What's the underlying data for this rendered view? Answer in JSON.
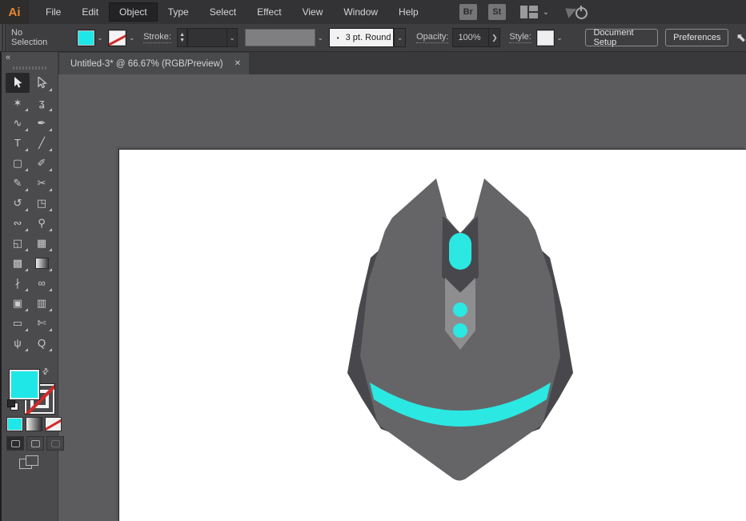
{
  "app": {
    "logo_text": "Ai"
  },
  "menu_bar": {
    "items": [
      "File",
      "Edit",
      "Object",
      "Type",
      "Select",
      "Effect",
      "View",
      "Window",
      "Help"
    ],
    "active_item": "Object",
    "bridge_button": "Br",
    "stock_button": "St"
  },
  "control_bar": {
    "selection_status": "No Selection",
    "stroke_label": "Stroke:",
    "stroke_width_value": "",
    "brush_bullet": "•",
    "brush_value": "3 pt. Round",
    "opacity_label": "Opacity:",
    "opacity_value": "100%",
    "style_label": "Style:",
    "document_setup_label": "Document Setup",
    "preferences_label": "Preferences"
  },
  "document_tab": {
    "title": "Untitled-3* @ 66.67% (RGB/Preview)"
  },
  "toolbar": {
    "tools": [
      {
        "name": "selection-tool",
        "icon": "selection-tool-icon",
        "active": true
      },
      {
        "name": "direct-selection-tool",
        "icon": "direct-selection-tool-icon",
        "active": false
      },
      {
        "name": "magic-wand-tool",
        "icon": "magic-wand-tool-icon",
        "active": false
      },
      {
        "name": "lasso-tool",
        "icon": "lasso-tool-icon",
        "active": false
      },
      {
        "name": "curvature-tool",
        "icon": "curvature-tool-icon",
        "active": false
      },
      {
        "name": "pen-tool",
        "icon": "pen-tool-icon",
        "active": false
      },
      {
        "name": "type-tool",
        "icon": "type-tool-icon",
        "active": false
      },
      {
        "name": "line-segment-tool",
        "icon": "line-tool-icon",
        "active": false
      },
      {
        "name": "rectangle-tool",
        "icon": "rectangle-tool-icon",
        "active": false
      },
      {
        "name": "paintbrush-tool",
        "icon": "paintbrush-tool-icon",
        "active": false
      },
      {
        "name": "pencil-tool",
        "icon": "pencil-tool-icon",
        "active": false
      },
      {
        "name": "scissors-tool",
        "icon": "scissors-tool-icon",
        "active": false
      },
      {
        "name": "rotate-tool",
        "icon": "rotate-tool-icon",
        "active": false
      },
      {
        "name": "scale-tool",
        "icon": "scale-tool-icon",
        "active": false
      },
      {
        "name": "width-tool",
        "icon": "width-tool-icon",
        "active": false
      },
      {
        "name": "puppet-warp-tool",
        "icon": "puppet-warp-tool-icon",
        "active": false
      },
      {
        "name": "shape-builder-tool",
        "icon": "shape-builder-tool-icon",
        "active": false
      },
      {
        "name": "perspective-grid-tool",
        "icon": "perspective-grid-tool-icon",
        "active": false
      },
      {
        "name": "mesh-tool",
        "icon": "mesh-tool-icon",
        "active": false
      },
      {
        "name": "gradient-tool",
        "icon": "gradient-tool-icon",
        "active": false
      },
      {
        "name": "eyedropper-tool",
        "icon": "eyedropper-tool-icon",
        "active": false
      },
      {
        "name": "blend-tool",
        "icon": "blend-tool-icon",
        "active": false
      },
      {
        "name": "symbol-sprayer-tool",
        "icon": "symbol-sprayer-tool-icon",
        "active": false
      },
      {
        "name": "column-graph-tool",
        "icon": "graph-tool-icon",
        "active": false
      },
      {
        "name": "artboard-tool",
        "icon": "artboard-tool-icon",
        "active": false
      },
      {
        "name": "slice-tool",
        "icon": "slice-tool-icon",
        "active": false
      },
      {
        "name": "hand-tool",
        "icon": "hand-tool-icon",
        "active": false
      },
      {
        "name": "zoom-tool",
        "icon": "zoom-tool-icon",
        "active": false
      }
    ]
  },
  "colors": {
    "ui_fill_swatch": "#1fe7e7",
    "accent": "#2be8e2",
    "mouse_body": "#656568",
    "mouse_wing": "#48484c",
    "mouse_strip_dark": "#48484c",
    "mouse_strip_light": "#8e8e90",
    "artboard": "#ffffff"
  },
  "artwork": {
    "subject_colors": {
      "body": "#656568",
      "wing": "#48484c",
      "strip_dark": "#48484c",
      "strip_light": "#8e8e90",
      "accent": "#2be8e2"
    }
  }
}
